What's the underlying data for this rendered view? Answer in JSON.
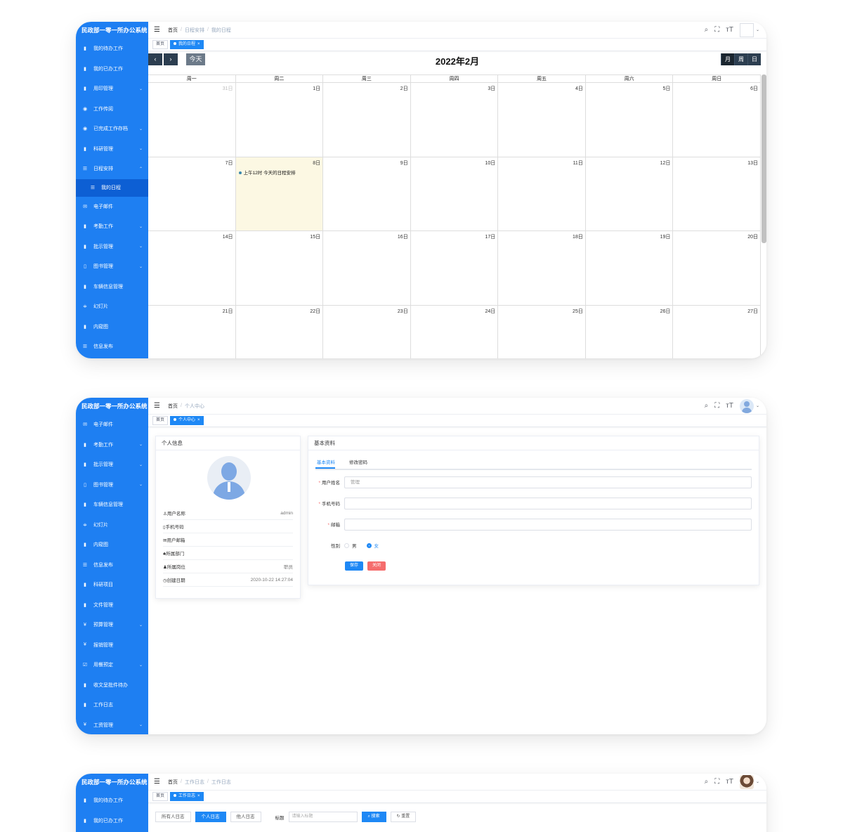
{
  "screen1": {
    "logo": "民政部一零一所办公系统",
    "menu": [
      {
        "icon": "▮",
        "label": "我的待办工作",
        "arrow": ""
      },
      {
        "icon": "▮",
        "label": "我的已办工作",
        "arrow": ""
      },
      {
        "icon": "▮",
        "label": "用印管理",
        "arrow": "⌄"
      },
      {
        "icon": "◉",
        "label": "工作传阅",
        "arrow": ""
      },
      {
        "icon": "◉",
        "label": "已完成工作存档",
        "arrow": "⌄"
      },
      {
        "icon": "▮",
        "label": "科研管理",
        "arrow": "⌄"
      },
      {
        "icon": "☰",
        "label": "日程安排",
        "arrow": "⌃"
      }
    ],
    "active_sub": {
      "icon": "☰",
      "label": "我的日程"
    },
    "menu_after": [
      {
        "icon": "✉",
        "label": "电子邮件",
        "arrow": ""
      },
      {
        "icon": "▮",
        "label": "考勤工作",
        "arrow": "⌄"
      },
      {
        "icon": "▮",
        "label": "批示管理",
        "arrow": "⌄"
      },
      {
        "icon": "▯",
        "label": "图书管理",
        "arrow": "⌄"
      },
      {
        "icon": "▮",
        "label": "车辆信息管理",
        "arrow": ""
      },
      {
        "icon": "≑",
        "label": "幻灯片",
        "arrow": ""
      },
      {
        "icon": "▮",
        "label": "内窥图",
        "arrow": ""
      },
      {
        "icon": "☰",
        "label": "信息发布",
        "arrow": ""
      }
    ],
    "breadcrumb": [
      "首页",
      "日程安排",
      "我的日程"
    ],
    "tags": {
      "home": "首页",
      "active": "我的日程"
    },
    "calendar": {
      "prev": "‹",
      "next": "›",
      "today": "今天",
      "title": "2022年2月",
      "views": [
        "月",
        "周",
        "日"
      ],
      "weekdays": [
        "周一",
        "周二",
        "周三",
        "周四",
        "周五",
        "周六",
        "周日"
      ],
      "days": [
        "31日",
        "1日",
        "2日",
        "3日",
        "4日",
        "5日",
        "6日",
        "7日",
        "8日",
        "9日",
        "10日",
        "11日",
        "12日",
        "13日",
        "14日",
        "15日",
        "16日",
        "17日",
        "18日",
        "19日",
        "20日",
        "21日",
        "22日",
        "23日",
        "24日",
        "25日",
        "26日",
        "27日"
      ],
      "event": "上午12时 今天的日程安排"
    }
  },
  "screen2": {
    "logo": "民政部一零一所办公系统",
    "menu": [
      {
        "icon": "✉",
        "label": "电子邮件",
        "arrow": ""
      },
      {
        "icon": "▮",
        "label": "考勤工作",
        "arrow": "⌄"
      },
      {
        "icon": "▮",
        "label": "批示管理",
        "arrow": "⌄"
      },
      {
        "icon": "▯",
        "label": "图书管理",
        "arrow": "⌄"
      },
      {
        "icon": "▮",
        "label": "车辆信息管理",
        "arrow": ""
      },
      {
        "icon": "≑",
        "label": "幻灯片",
        "arrow": ""
      },
      {
        "icon": "▮",
        "label": "内窥图",
        "arrow": ""
      },
      {
        "icon": "☰",
        "label": "信息发布",
        "arrow": ""
      },
      {
        "icon": "▮",
        "label": "科研项目",
        "arrow": ""
      },
      {
        "icon": "▮",
        "label": "文件管理",
        "arrow": ""
      },
      {
        "icon": "¥",
        "label": "预算管理",
        "arrow": "⌄"
      },
      {
        "icon": "¥",
        "label": "报销管理",
        "arrow": ""
      },
      {
        "icon": "☑",
        "label": "用餐预定",
        "arrow": "⌄"
      },
      {
        "icon": "▮",
        "label": "收文呈批件待办",
        "arrow": ""
      },
      {
        "icon": "▮",
        "label": "工作日志",
        "arrow": ""
      },
      {
        "icon": "¥",
        "label": "工资管理",
        "arrow": "⌄"
      }
    ],
    "breadcrumb": [
      "首页",
      "个人中心"
    ],
    "tags": {
      "home": "首页",
      "active": "个人中心"
    },
    "personal": {
      "title": "个人信息",
      "rows": [
        {
          "label": "用户名称",
          "value": "admin"
        },
        {
          "label": "手机号码",
          "value": ""
        },
        {
          "label": "用户邮箱",
          "value": ""
        },
        {
          "label": "所属部门",
          "value": ""
        },
        {
          "label": "所属岗位",
          "value": "职员"
        },
        {
          "label": "创建日期",
          "value": "2020-10-22 14:27:04"
        }
      ]
    },
    "basic": {
      "title": "基本资料",
      "tabs": [
        "基本资料",
        "修改密码"
      ],
      "fields": {
        "username_label": "用户姓名",
        "username_value": "管理",
        "phone_label": "手机号码",
        "email_label": "邮箱",
        "gender_label": "性别",
        "male": "男",
        "female": "女"
      },
      "save": "保存",
      "close": "关闭"
    }
  },
  "screen3": {
    "logo": "民政部一零一所办公系统",
    "menu": [
      {
        "icon": "▮",
        "label": "我的待办工作",
        "arrow": ""
      },
      {
        "icon": "▮",
        "label": "我的已办工作",
        "arrow": ""
      }
    ],
    "breadcrumb": [
      "首页",
      "工作日志",
      "工作日志"
    ],
    "tags": {
      "home": "首页",
      "active": "工作日志"
    },
    "filters": [
      "所有人日志",
      "个人日志",
      "他人日志"
    ],
    "title_label": "标题",
    "search_placeholder": "请输入标题",
    "search": "搜索",
    "reset": "重置"
  },
  "toolbar_icons": {
    "search": "⌕",
    "fullscreen": "⛶",
    "fontsize": "ᴛT",
    "caret": "⌄"
  }
}
